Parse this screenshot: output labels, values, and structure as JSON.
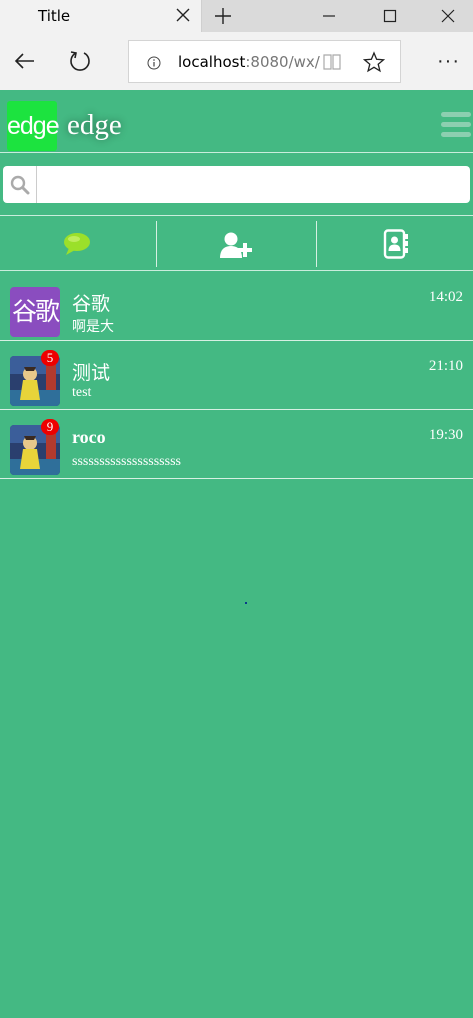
{
  "browser": {
    "tab_title": "Title",
    "address_host": "localhost",
    "address_path": ":8080/wx/",
    "more_label": "···"
  },
  "app": {
    "logo_text": "edge",
    "title": "edge",
    "logo_color": "#1ce33f",
    "bg_color": "#44b983"
  },
  "search": {
    "placeholder": "",
    "value": ""
  },
  "tabs": [
    {
      "icon": "chat-bubble-icon",
      "active": true
    },
    {
      "icon": "add-user-icon",
      "active": false
    },
    {
      "icon": "contacts-icon",
      "active": false
    }
  ],
  "conversations": [
    {
      "name": "谷歌",
      "avatar_text": "谷歌",
      "last_message": "啊是大",
      "time": "14:02",
      "badge": ""
    },
    {
      "name": "测试",
      "avatar_text": "",
      "last_message": "test",
      "time": "21:10",
      "badge": "5"
    },
    {
      "name": "roco",
      "avatar_text": "",
      "last_message": "ssssssssssssssssssss",
      "time": "19:30",
      "badge": "9"
    }
  ]
}
